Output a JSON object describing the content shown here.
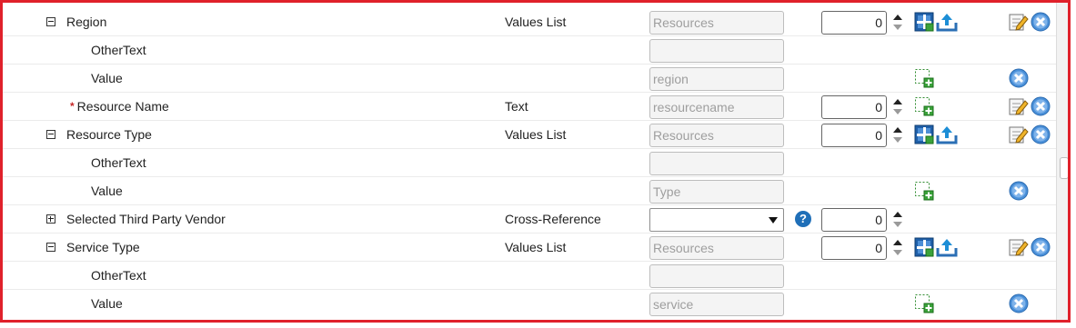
{
  "rows": [
    {
      "label": "Region",
      "field_type": "Values List",
      "text_value": "Resources",
      "number_value": "0"
    },
    {
      "label": "OtherText",
      "text_value": ""
    },
    {
      "label": "Value",
      "text_value": "region"
    },
    {
      "required_mark": "*",
      "label": "Resource Name",
      "field_type": "Text",
      "text_value": "resourcename",
      "number_value": "0"
    },
    {
      "label": "Resource Type",
      "field_type": "Values List",
      "text_value": "Resources",
      "number_value": "0"
    },
    {
      "label": "OtherText",
      "text_value": ""
    },
    {
      "label": "Value",
      "text_value": "Type"
    },
    {
      "label": "Selected Third Party Vendor",
      "field_type": "Cross-Reference",
      "select_value": "",
      "help_glyph": "?",
      "number_value": "0"
    },
    {
      "label": "Service Type",
      "field_type": "Values List",
      "text_value": "Resources",
      "number_value": "0"
    },
    {
      "label": "OtherText",
      "text_value": ""
    },
    {
      "label": "Value",
      "text_value": "service"
    }
  ]
}
